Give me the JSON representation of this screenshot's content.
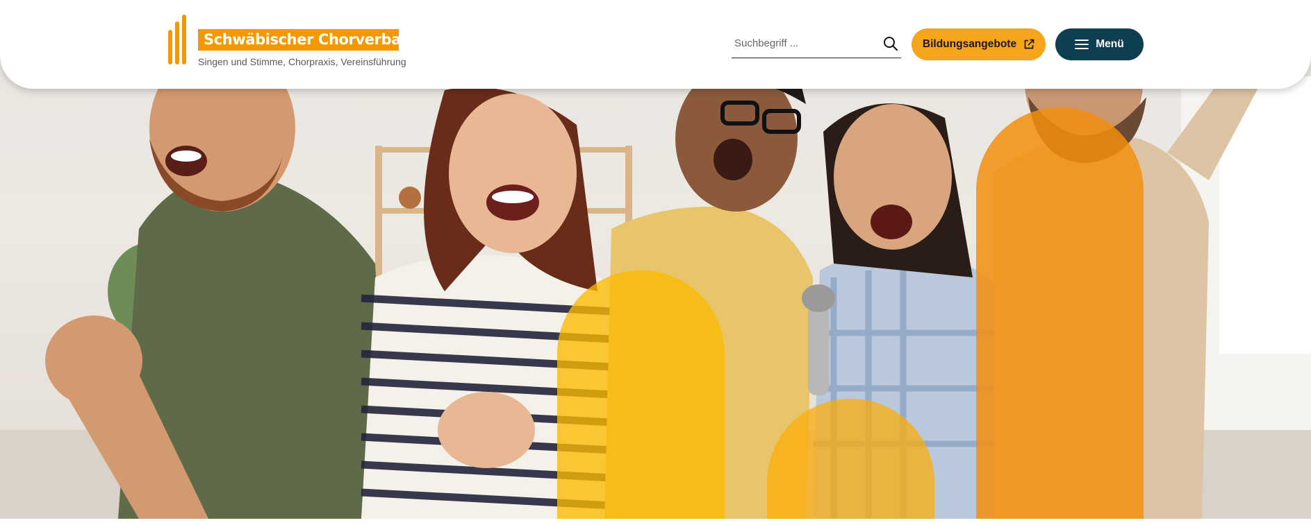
{
  "header": {
    "logo": {
      "name": "Schwäbischer Chorverband",
      "tagline": "Singen und Stimme, Chorpraxis, Vereinsführung"
    },
    "search": {
      "placeholder": "Suchbegriff ...",
      "value": "",
      "icon": "search-icon"
    },
    "education_button": {
      "label": "Bildungsangebote",
      "icon": "external-link-icon"
    },
    "menu_button": {
      "label": "Menü",
      "icon": "hamburger-menu-icon"
    }
  },
  "hero": {
    "image_subject": "group of people singing",
    "accent_shapes": [
      "#fbba00",
      "#fcad09",
      "#f48e0c"
    ]
  },
  "colors": {
    "brand_orange": "#f39800",
    "button_orange": "#f7a41d",
    "dark_teal": "#0e3e51"
  }
}
